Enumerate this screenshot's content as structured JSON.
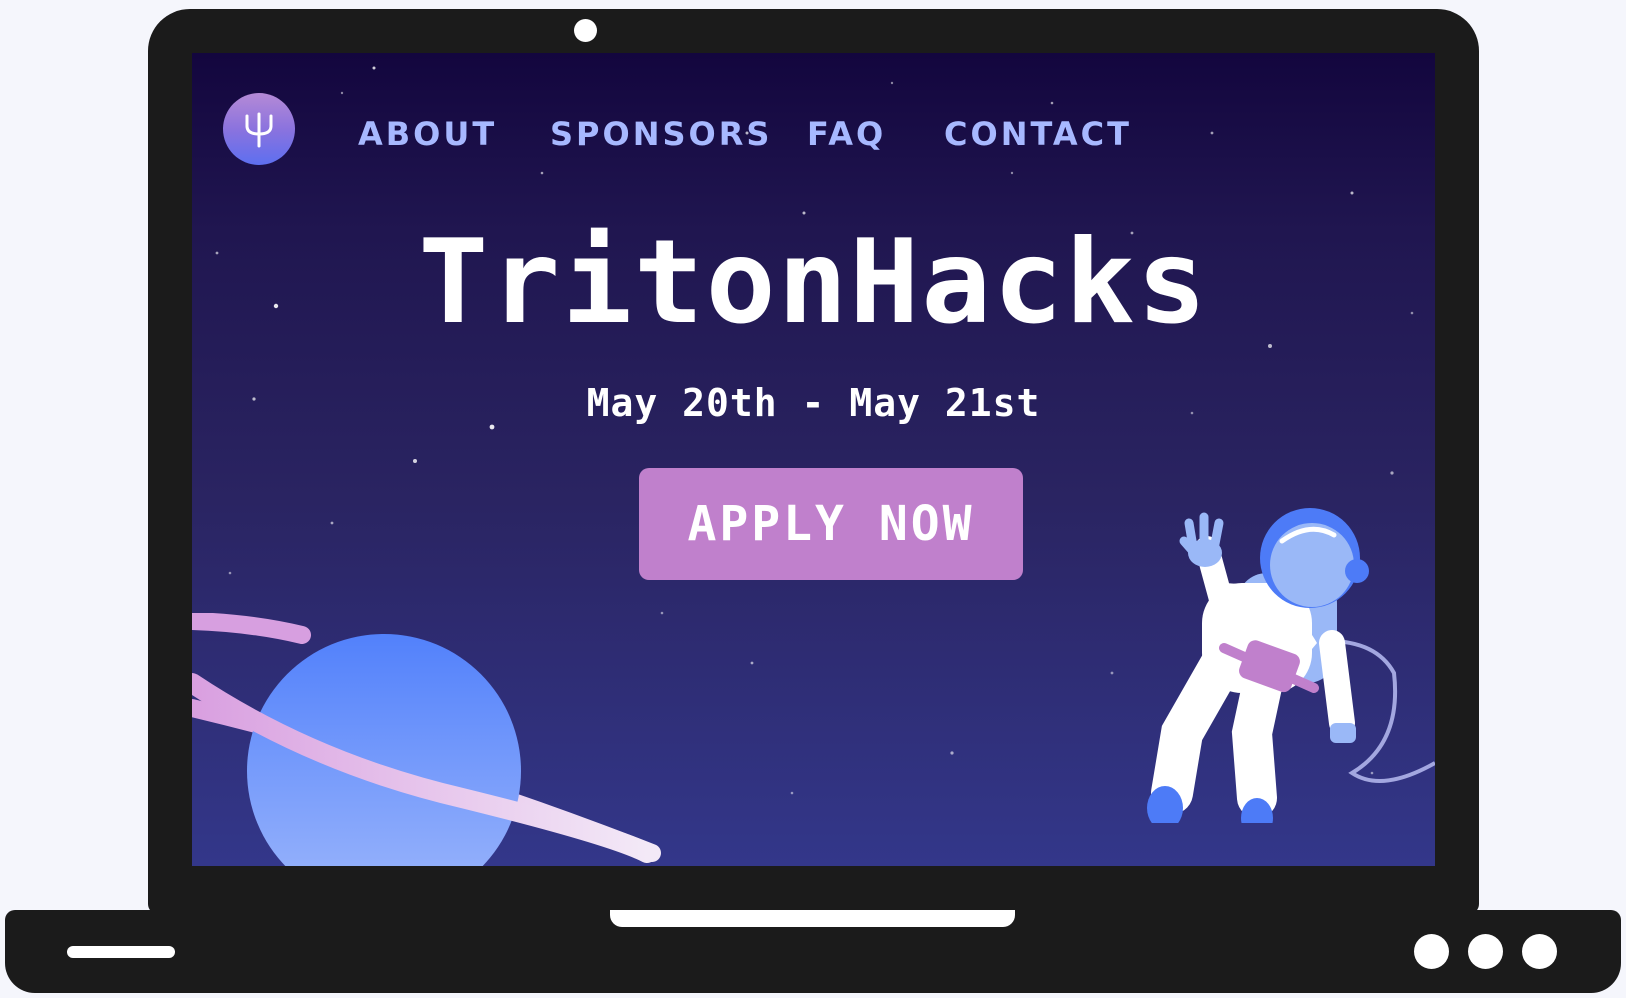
{
  "nav": {
    "logo_icon": "trident-icon",
    "items": [
      {
        "label": "ABOUT"
      },
      {
        "label": "SPONSORS"
      },
      {
        "label": "FAQ"
      },
      {
        "label": "CONTACT"
      }
    ]
  },
  "hero": {
    "title": "TritonHacks",
    "date": "May 20th - May 21st",
    "cta_label": "APPLY NOW"
  },
  "illustrations": {
    "planet": "ringed-planet-illustration",
    "astronaut": "waving-astronaut-illustration"
  },
  "colors": {
    "nav_text": "#a7b8ff",
    "button_bg": "#c080cc",
    "title_text": "#ffffff",
    "planet": "#6a8cf8",
    "ring": "#e4bce6",
    "bg_top": "#13063e",
    "bg_bottom": "#33378a"
  }
}
